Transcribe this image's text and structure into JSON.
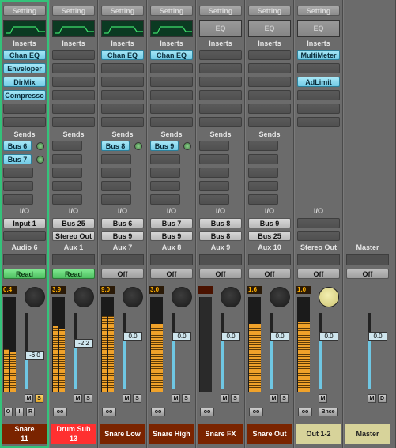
{
  "labels": {
    "setting": "Setting",
    "eq": "EQ",
    "inserts": "Inserts",
    "sends": "Sends",
    "io": "I/O"
  },
  "strips": [
    {
      "name": "Audio 6",
      "eq": "on",
      "inserts": [
        "Chan EQ",
        "Enveloper",
        "DirMix",
        "Compresso"
      ],
      "sends": [
        "Bus 6",
        "Bus 7"
      ],
      "send_knobs": [
        true,
        true
      ],
      "io": [
        "Input 1",
        ""
      ],
      "auto": "Read",
      "auto_style": "green",
      "peak": "0.4",
      "volume": "-6.0",
      "level": 0.45,
      "meterL": 0.45,
      "meterR": 0.42,
      "pan": "dark",
      "sm": [
        "M",
        "S"
      ],
      "solo": true,
      "bottom": [
        "O",
        "I",
        "R"
      ],
      "label": "Snare\n11",
      "label_bg": "#7a2400",
      "selected": true
    },
    {
      "name": "Aux 1",
      "eq": "on",
      "inserts": [
        "",
        "",
        "",
        ""
      ],
      "sends": [
        "",
        ""
      ],
      "send_knobs": [
        false,
        false
      ],
      "io": [
        "Bus 25",
        "Stereo Out"
      ],
      "auto": "Read",
      "auto_style": "green",
      "peak": "3.9",
      "volume": "-2.2",
      "level": 0.6,
      "meterL": 0.7,
      "meterR": 0.66,
      "pan": "dark",
      "sm": [
        "M",
        "S"
      ],
      "solo": false,
      "bottom": [
        "oo"
      ],
      "label": "Drum Sub\n13",
      "label_bg": "#ff3030",
      "selected": false
    },
    {
      "name": "Aux 7",
      "eq": "on",
      "inserts": [
        "Chan EQ",
        "",
        "",
        ""
      ],
      "sends": [
        "Bus 8",
        ""
      ],
      "send_knobs": [
        true,
        false
      ],
      "io": [
        "Bus 6",
        "Bus 9"
      ],
      "auto": "Off",
      "auto_style": "auto",
      "peak": "9.0",
      "volume": "0.0",
      "level": 0.7,
      "meterL": 0.8,
      "meterR": 0.8,
      "pan": "dark",
      "sm": [
        "M",
        "S"
      ],
      "solo": false,
      "bottom": [
        "oo"
      ],
      "label": "Snare Low",
      "label_bg": "#7a2400",
      "selected": false
    },
    {
      "name": "Aux 8",
      "eq": "on",
      "inserts": [
        "Chan EQ",
        "",
        "",
        ""
      ],
      "sends": [
        "Bus 9",
        ""
      ],
      "send_knobs": [
        true,
        false
      ],
      "io": [
        "Bus 7",
        "Bus 9"
      ],
      "auto": "Off",
      "auto_style": "auto",
      "peak": "3.0",
      "volume": "0.0",
      "level": 0.7,
      "meterL": 0.72,
      "meterR": 0.72,
      "pan": "dark",
      "sm": [
        "M",
        "S"
      ],
      "solo": false,
      "bottom": [
        "oo"
      ],
      "label": "Snare High",
      "label_bg": "#7a2400",
      "selected": false
    },
    {
      "name": "Aux 9",
      "eq": "off",
      "inserts": [
        "",
        "",
        "",
        ""
      ],
      "sends": [
        "",
        ""
      ],
      "send_knobs": [
        false,
        false
      ],
      "io": [
        "Bus 8",
        "Bus 8"
      ],
      "auto": "Off",
      "auto_style": "auto",
      "peak": "",
      "volume": "0.0",
      "level": 0.7,
      "meterL": 0,
      "meterR": 0,
      "pan": "dark",
      "sm": [
        "M",
        "S"
      ],
      "solo": false,
      "bottom": [
        "oo"
      ],
      "label": "Snare FX",
      "label_bg": "#7a2400",
      "selected": false
    },
    {
      "name": "Aux 10",
      "eq": "off",
      "inserts": [
        "",
        "",
        "",
        ""
      ],
      "sends": [
        "",
        ""
      ],
      "send_knobs": [
        false,
        false
      ],
      "io": [
        "Bus 9",
        "Bus 25"
      ],
      "auto": "Off",
      "auto_style": "auto",
      "peak": "1.6",
      "volume": "0.0",
      "level": 0.7,
      "meterL": 0.72,
      "meterR": 0.72,
      "pan": "dark",
      "sm": [
        "M",
        "S"
      ],
      "solo": false,
      "bottom": [
        "oo"
      ],
      "label": "Snare Out",
      "label_bg": "#7a2400",
      "selected": false
    },
    {
      "name": "Stereo Out",
      "eq": "off",
      "inserts": [
        "MultiMeter",
        "",
        "AdLimit",
        ""
      ],
      "sends": null,
      "send_knobs": [],
      "io": [
        "",
        ""
      ],
      "auto": "Off",
      "auto_style": "auto",
      "peak": "1.0",
      "volume": "0.0",
      "level": 0.7,
      "meterL": 0.74,
      "meterR": 0.74,
      "pan": "yellow",
      "sm": [
        "M"
      ],
      "solo": false,
      "bottom": [
        "oo",
        "Bnce"
      ],
      "label": "Out 1-2",
      "label_bg": "#d7d39a",
      "selected": false
    },
    {
      "name": "Master",
      "eq": "none",
      "inserts": null,
      "sends": null,
      "send_knobs": [],
      "io": null,
      "auto": "Off",
      "auto_style": "auto",
      "peak": "",
      "volume": "0.0",
      "level": 0.7,
      "meterL": 0,
      "meterR": 0,
      "pan": "none",
      "sm": [
        "M",
        "D"
      ],
      "solo": false,
      "bottom": [],
      "label": "Master",
      "label_bg": "#d7d39a",
      "selected": false
    }
  ]
}
